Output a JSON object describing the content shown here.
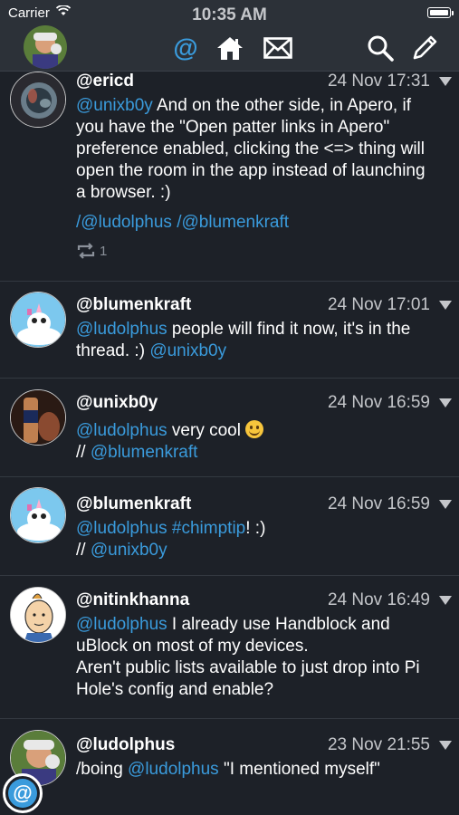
{
  "status_bar": {
    "carrier": "Carrier",
    "time": "10:35 AM"
  },
  "nav": {
    "at_label": "@",
    "icons": [
      "profile-avatar",
      "mentions-icon",
      "home-icon",
      "mail-icon",
      "search-icon",
      "compose-icon"
    ],
    "accent": "#3a9bdc"
  },
  "posts": [
    {
      "username": "@ericd",
      "time": "24 Nov 17:31",
      "mention": "@unixb0y",
      "text": " And on the other side, in Apero, if you have the \"Open patter links in Apero\" preference enabled, clicking the <=> thing will open the room in the app instead of launching a browser. :)",
      "links": "/@ludolphus /@blumenkraft",
      "repost_count": "1"
    },
    {
      "username": "@blumenkraft",
      "time": "24 Nov 17:01",
      "mention": "@ludolphus",
      "text": " people will find it now, it's in the thread. :) ",
      "trailing_mention": "@unixb0y"
    },
    {
      "username": "@unixb0y",
      "time": "24 Nov 16:59",
      "mention": "@ludolphus",
      "text": " very cool ",
      "line2_prefix": "// ",
      "line2_mention": "@blumenkraft"
    },
    {
      "username": "@blumenkraft",
      "time": "24 Nov 16:59",
      "mention": "@ludolphus",
      "hashtag": " #chimptip",
      "text": "! :)",
      "line2_prefix": "// ",
      "line2_mention": "@unixb0y"
    },
    {
      "username": "@nitinkhanna",
      "time": "24 Nov 16:49",
      "mention": "@ludolphus",
      "text": " I already use Handblock and uBlock on most of my devices.\nAren't public lists available to just drop into Pi Hole's config and enable?"
    },
    {
      "username": "@ludolphus",
      "time": "23 Nov 21:55",
      "prefix": "/boing ",
      "mention": "@ludolphus",
      "text": " \"I mentioned myself\""
    }
  ],
  "fab_label": "@"
}
